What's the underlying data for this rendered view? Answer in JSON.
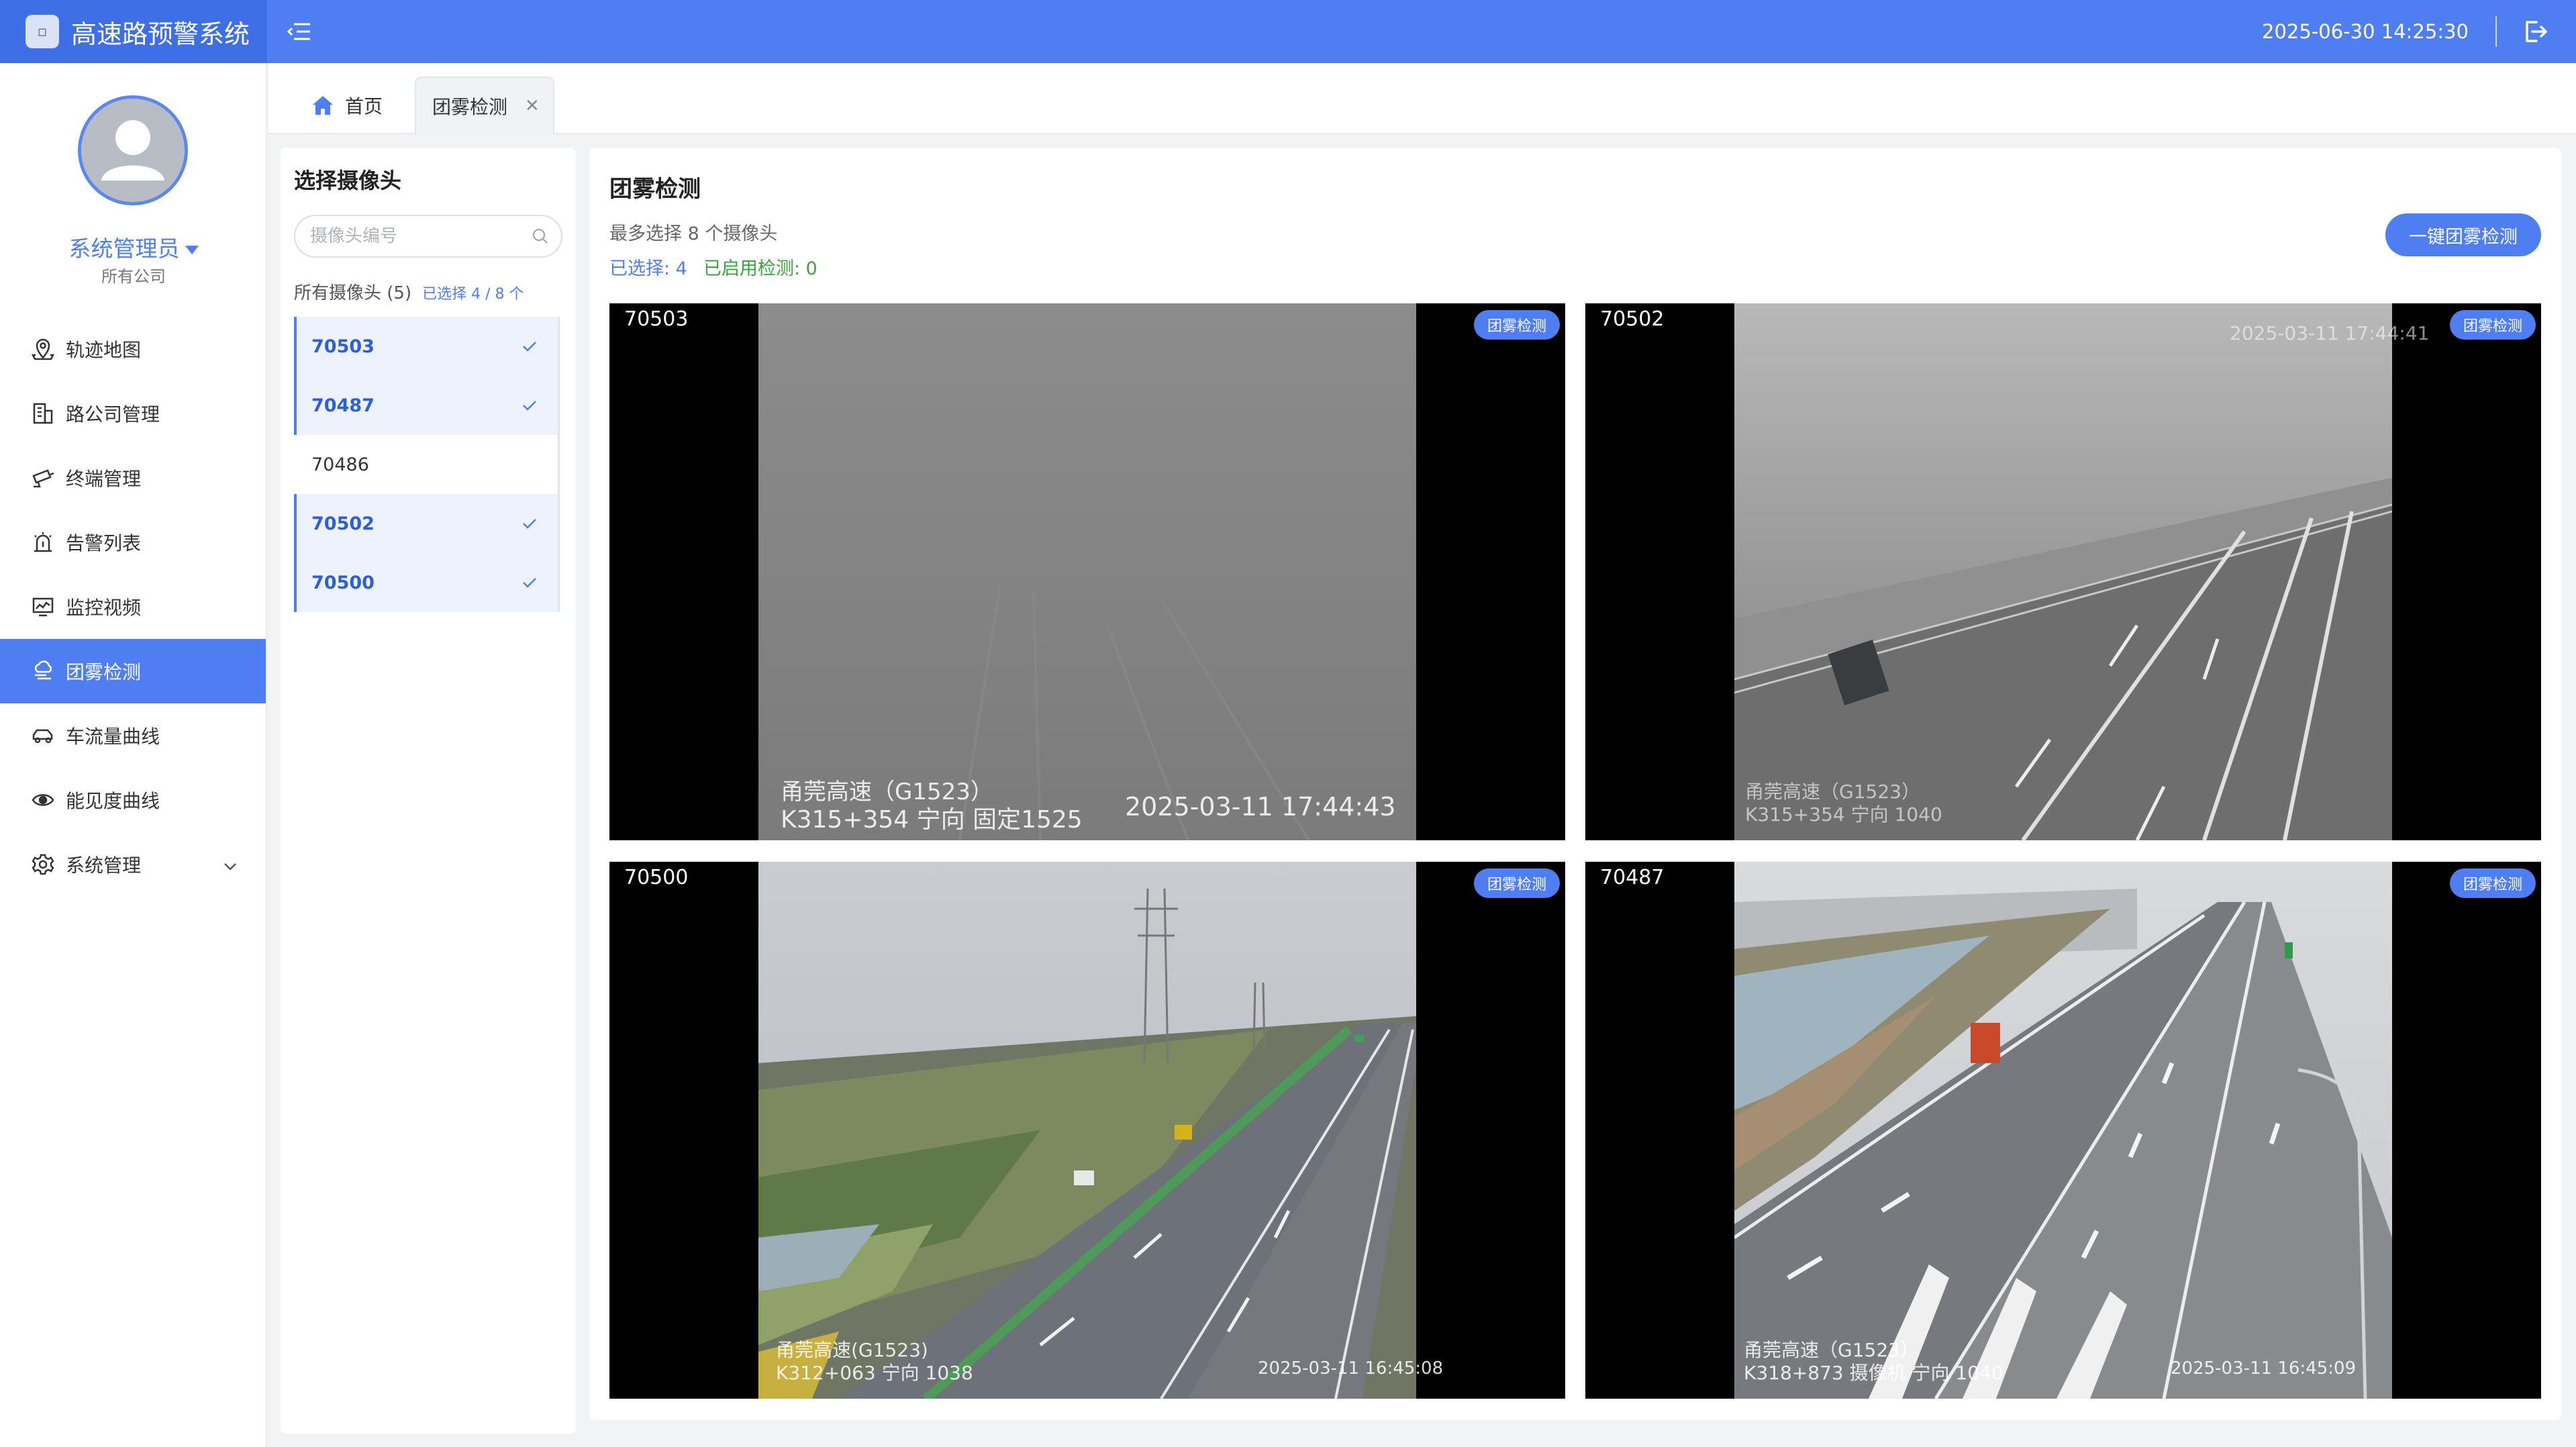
{
  "app": {
    "title": "高速路预警系统",
    "datetime": "2025-06-30 14:25:30"
  },
  "user": {
    "name": "系统管理员",
    "company": "所有公司"
  },
  "nav": {
    "items": [
      {
        "label": "轨迹地图",
        "icon": "map-pin-icon"
      },
      {
        "label": "路公司管理",
        "icon": "building-icon"
      },
      {
        "label": "终端管理",
        "icon": "camera-terminal-icon"
      },
      {
        "label": "告警列表",
        "icon": "alarm-icon"
      },
      {
        "label": "监控视频",
        "icon": "monitor-chart-icon"
      },
      {
        "label": "团雾检测",
        "icon": "cloud-fog-icon",
        "active": true
      },
      {
        "label": "车流量曲线",
        "icon": "car-icon"
      },
      {
        "label": "能见度曲线",
        "icon": "eye-icon"
      },
      {
        "label": "系统管理",
        "icon": "gear-icon"
      }
    ]
  },
  "tabs": {
    "home": "首页",
    "current": "团雾检测"
  },
  "camera_panel": {
    "title": "选择摄像头",
    "search_placeholder": "摄像头编号",
    "all_label": "所有摄像头 (5)",
    "selected_label": "已选择 4 / 8 个",
    "cameras": [
      {
        "id": "70503",
        "selected": true
      },
      {
        "id": "70487",
        "selected": true
      },
      {
        "id": "70486",
        "selected": false
      },
      {
        "id": "70502",
        "selected": true
      },
      {
        "id": "70500",
        "selected": true
      }
    ]
  },
  "main": {
    "title": "团雾检测",
    "subtitle": "最多选择 8 个摄像头",
    "selected_stat": "已选择: 4",
    "enabled_stat": "已启用检测: 0",
    "detect_all_button": "一键团雾检测",
    "fog_button": "团雾检测",
    "videos": [
      {
        "id": "70503",
        "osd_road": "甬莞高速（G1523）",
        "osd_location": "K315+354 宁向 固定1525",
        "osd_time": "2025-03-11 17:44:43"
      },
      {
        "id": "70502",
        "osd_road": "甬莞高速（G1523）",
        "osd_location": "K315+354 宁向 1040",
        "osd_time": "2025-03-11 17:44:41"
      },
      {
        "id": "70500",
        "osd_road": "甬莞高速(G1523)",
        "osd_location": "K312+063 宁向 1038",
        "osd_time": "2025-03-11 16:45:08"
      },
      {
        "id": "70487",
        "osd_road": "甬莞高速（G1523）",
        "osd_location": "K318+873 摄像机 宁向 1040",
        "osd_time": "2025-03-11 16:45:09"
      }
    ]
  }
}
